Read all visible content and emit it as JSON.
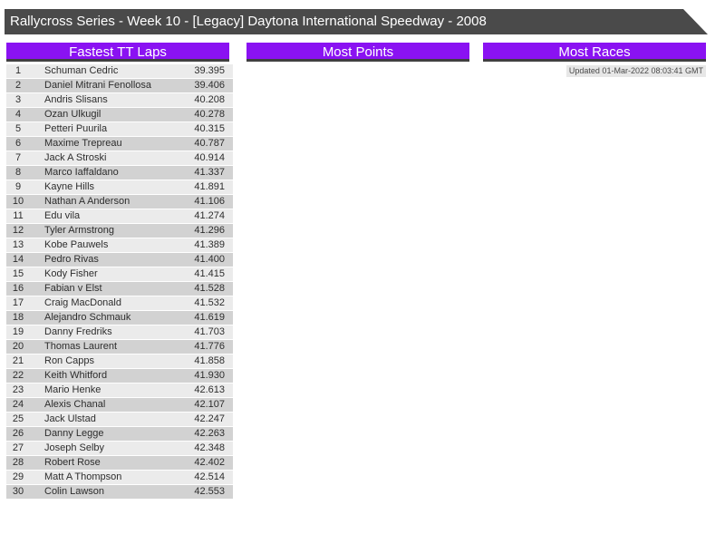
{
  "title": "Rallycross Series - Week 10 - [Legacy] Daytona International Speedway - 2008",
  "sections": {
    "fastest_tt_laps": {
      "title": "Fastest TT Laps"
    },
    "most_points": {
      "title": "Most Points"
    },
    "most_races": {
      "title": "Most Races"
    }
  },
  "updated": "Updated 01-Mar-2022 08:03:41 GMT",
  "colors": {
    "accent_purple": "#8a12f2",
    "banner_gray": "#4a4a4a",
    "row_odd": "#ebebeb",
    "row_even": "#d2d2d2"
  },
  "fastest_tt_laps": {
    "columns": [
      "rank",
      "driver",
      "time"
    ],
    "rows": [
      [
        "1",
        "Schuman Cedric",
        "39.395"
      ],
      [
        "2",
        "Daniel Mitrani Fenollosa",
        "39.406"
      ],
      [
        "3",
        "Andris Slisans",
        "40.208"
      ],
      [
        "4",
        "Ozan Ulkugil",
        "40.278"
      ],
      [
        "5",
        "Petteri Puurila",
        "40.315"
      ],
      [
        "6",
        "Maxime Trepreau",
        "40.787"
      ],
      [
        "7",
        "Jack A Stroski",
        "40.914"
      ],
      [
        "8",
        "Marco Iaffaldano",
        "41.337"
      ],
      [
        "9",
        "Kayne Hills",
        "41.891"
      ],
      [
        "10",
        "Nathan A Anderson",
        "41.106"
      ],
      [
        "11",
        "Edu vila",
        "41.274"
      ],
      [
        "12",
        "Tyler Armstrong",
        "41.296"
      ],
      [
        "13",
        "Kobe Pauwels",
        "41.389"
      ],
      [
        "14",
        "Pedro Rivas",
        "41.400"
      ],
      [
        "15",
        "Kody Fisher",
        "41.415"
      ],
      [
        "16",
        "Fabian v Elst",
        "41.528"
      ],
      [
        "17",
        "Craig MacDonald",
        "41.532"
      ],
      [
        "18",
        "Alejandro Schmauk",
        "41.619"
      ],
      [
        "19",
        "Danny Fredriks",
        "41.703"
      ],
      [
        "20",
        "Thomas Laurent",
        "41.776"
      ],
      [
        "21",
        "Ron Capps",
        "41.858"
      ],
      [
        "22",
        "Keith Whitford",
        "41.930"
      ],
      [
        "23",
        "Mario Henke",
        "42.613"
      ],
      [
        "24",
        "Alexis Chanal",
        "42.107"
      ],
      [
        "25",
        "Jack Ulstad",
        "42.247"
      ],
      [
        "26",
        "Danny Legge",
        "42.263"
      ],
      [
        "27",
        "Joseph Selby",
        "42.348"
      ],
      [
        "28",
        "Robert Rose",
        "42.402"
      ],
      [
        "29",
        "Matt A Thompson",
        "42.514"
      ],
      [
        "30",
        "Colin Lawson",
        "42.553"
      ]
    ]
  }
}
